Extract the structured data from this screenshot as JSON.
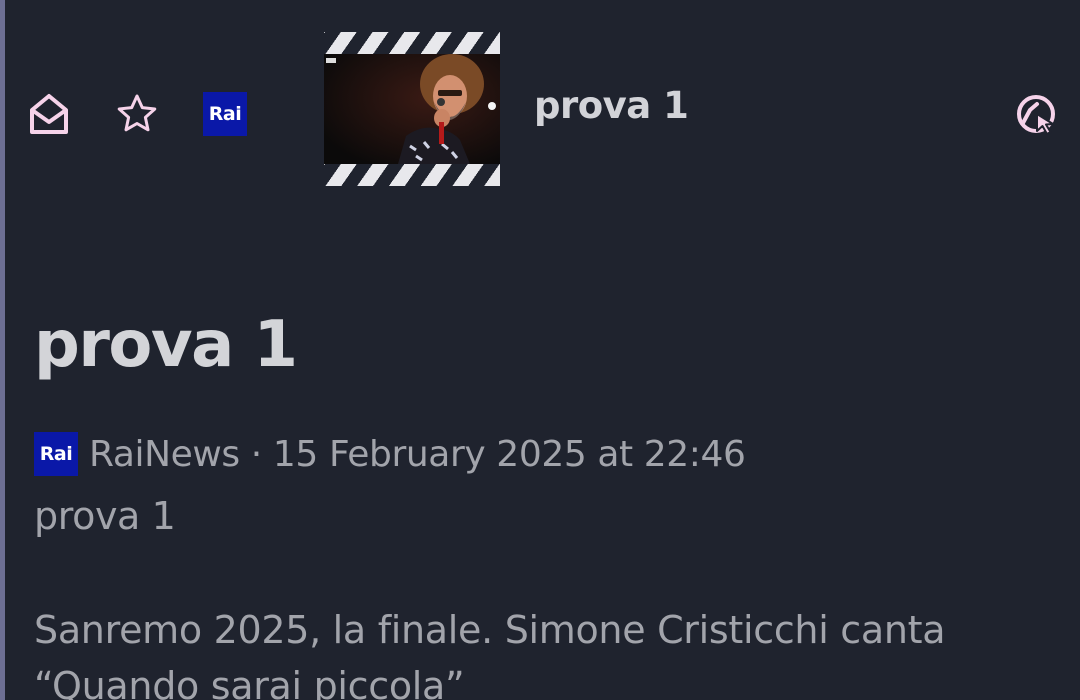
{
  "toolbar": {
    "icons": {
      "mail": "mail-open-icon",
      "star": "star-icon",
      "source": "rai-logo",
      "share": "share-icon"
    },
    "source_logo_text": "Rai",
    "title": "prova 1"
  },
  "article": {
    "title": "prova 1",
    "source_logo_text": "Rai",
    "byline": "RaiNews · 15 February 2025 at 22:46",
    "author": "prova 1",
    "body": "Sanremo 2025, la finale. Simone Cristicchi canta “Quando sarai piccola”"
  },
  "colors": {
    "background": "#1f232e",
    "icon_pink": "#f6d3ea",
    "rai_blue": "#0a18a8",
    "title_text": "#d3d4d8",
    "secondary_text": "#a2a4ab"
  }
}
